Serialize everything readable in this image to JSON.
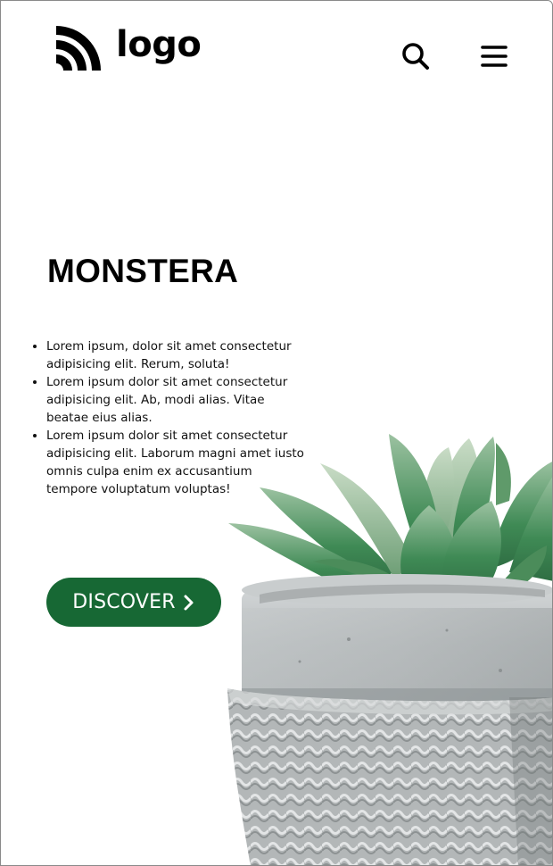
{
  "header": {
    "logo_text": "logo",
    "icons": [
      "logo-mark-icon",
      "search-icon",
      "hamburger-menu-icon"
    ]
  },
  "hero": {
    "title": "MONSTERA",
    "bullets": [
      "Lorem ipsum, dolor sit amet consectetur adipisicing elit. Rerum, soluta!",
      "Lorem ipsum dolor sit amet consectetur adipisicing elit. Ab, modi alias. Vitae beatae eius alias.",
      "Lorem ipsum dolor sit amet consectetur adipisicing elit. Laborum magni amet iusto omnis culpa enim ex accusantium tempore voluptatum voluptas!"
    ],
    "cta_label": "DISCOVER",
    "cta_icon": "chevron-right-icon"
  },
  "colors": {
    "accent": "#176834",
    "text": "#000000",
    "background": "#ffffff"
  }
}
